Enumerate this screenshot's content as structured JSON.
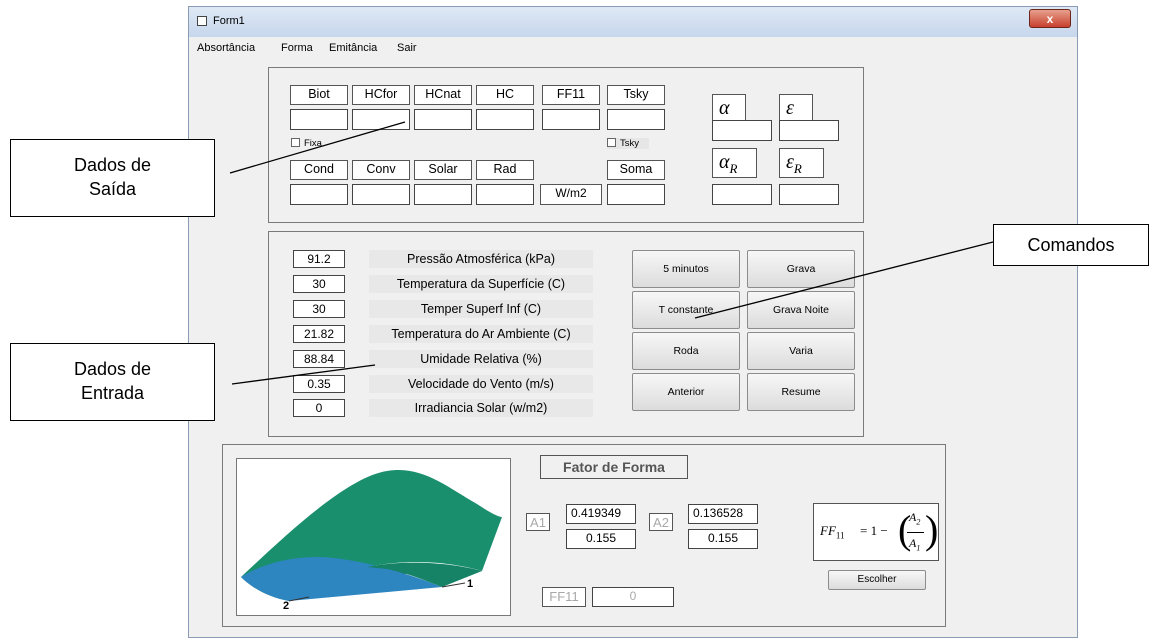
{
  "window": {
    "title": "Form1",
    "close_glyph": "x"
  },
  "menu": [
    "Absortância",
    "Forma",
    "Emitância",
    "Sair"
  ],
  "output": {
    "top_labels": [
      "Biot",
      "HCfor",
      "HCnat",
      "HC",
      "FF11",
      "Tsky"
    ],
    "fixa_label": "Fixa",
    "tsky_check_label": "Tsky",
    "bottom_labels": [
      "Cond",
      "Conv",
      "Solar",
      "Rad",
      "Soma"
    ],
    "units": "W/m2",
    "greek": {
      "alpha": "α",
      "epsilon": "ε",
      "alpha_r": "α",
      "epsilon_r": "ε",
      "sub_r": "R"
    }
  },
  "input": {
    "rows": [
      {
        "value": "91.2",
        "label": "Pressão Atmosférica (kPa)"
      },
      {
        "value": "30",
        "label": "Temperatura da Superfície (C)"
      },
      {
        "value": "30",
        "label": "Temper Superf Inf (C)"
      },
      {
        "value": "21.82",
        "label": "Temperatura do Ar Ambiente (C)"
      },
      {
        "value": "88.84",
        "label": "Umidade Relativa (%)"
      },
      {
        "value": "0.35",
        "label": "Velocidade do Vento (m/s)"
      },
      {
        "value": "0",
        "label": "Irradiancia Solar (w/m2)"
      }
    ]
  },
  "commands": [
    "5 minutos",
    "Grava",
    "T constante",
    "Grava Noite",
    "Roda",
    "Varia",
    "Anterior",
    "Resume"
  ],
  "form_factor": {
    "title": "Fator de Forma",
    "a1_label": "A1",
    "a1_top": "0.419349",
    "a1_bottom": "0.155",
    "a2_label": "A2",
    "a2_top": "0.136528",
    "a2_bottom": "0.155",
    "ff11_label": "FF11",
    "ff11_value": "0",
    "escolher": "Escolher",
    "surface1": "1",
    "surface2": "2",
    "formula": {
      "lhs": "FF",
      "lhs_sub": "11",
      "rhs": "= 1 −",
      "num": "A",
      "num_sub": "2",
      "den": "A",
      "den_sub": "1"
    }
  },
  "callouts": {
    "saida": "Dados de Saída",
    "entrada": "Dados de Entrada",
    "comandos": "Comandos"
  },
  "colors": {
    "surface_green": "#1a8f6e",
    "surface_blue": "#2e86c1",
    "close_red": "#c7412d"
  }
}
